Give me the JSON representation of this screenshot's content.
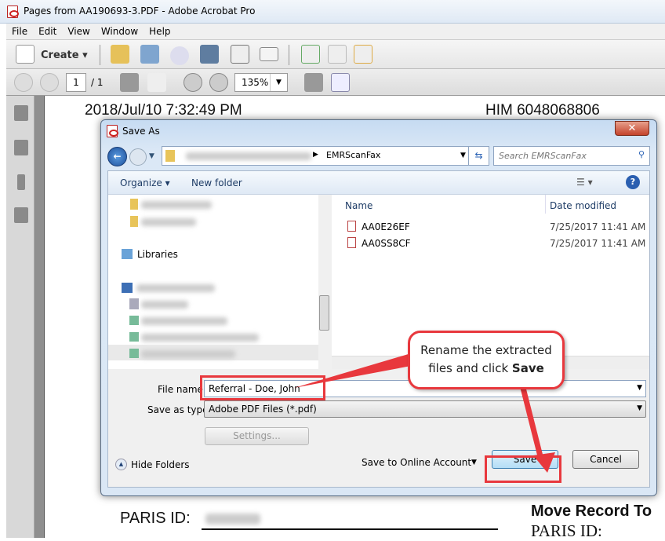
{
  "window": {
    "title": "Pages from AA190693-3.PDF - Adobe Acrobat Pro"
  },
  "menu": [
    "File",
    "Edit",
    "View",
    "Window",
    "Help"
  ],
  "toolbar": {
    "create_label": "Create",
    "icons": [
      "open-icon",
      "save-icon",
      "upload-cloud-icon",
      "print-icon",
      "edit-icon",
      "email-icon",
      "extract-icon",
      "delete-icon",
      "share-icon"
    ]
  },
  "nav": {
    "page": "1",
    "total": "/ 1",
    "zoom": "135%"
  },
  "document": {
    "header_left": "2018/Jul/10 7:32:49 PM",
    "header_right": "HIM 6048068806",
    "paris_label": "PARIS ID:",
    "move_label": "Move Record To",
    "paris_label2": "PARIS ID:"
  },
  "dialog": {
    "title": "Save As",
    "path_folder": "EMRScanFax",
    "search_placeholder": "Search EMRScanFax",
    "organize": "Organize",
    "new_folder": "New folder",
    "libraries": "Libraries",
    "columns": [
      "Name",
      "Date modified"
    ],
    "files": [
      {
        "name": "AA0E26EF",
        "date": "7/25/2017 11:41 AM"
      },
      {
        "name": "AA0SS8CF",
        "date": "7/25/2017 11:41 AM"
      }
    ],
    "file_name_label": "File name:",
    "file_name_value": "Referral - Doe, John",
    "save_type_label": "Save as type:",
    "save_type_value": "Adobe PDF Files (*.pdf)",
    "settings": "Settings...",
    "hide_folders": "Hide Folders",
    "online": "Save to Online Account",
    "save": "Save",
    "cancel": "Cancel"
  },
  "callout": {
    "text": "Rename the extracted files and click ",
    "bold": "Save"
  },
  "colors": {
    "annotation": "#e8383d",
    "dialog_frame": "#c6dbf2"
  }
}
